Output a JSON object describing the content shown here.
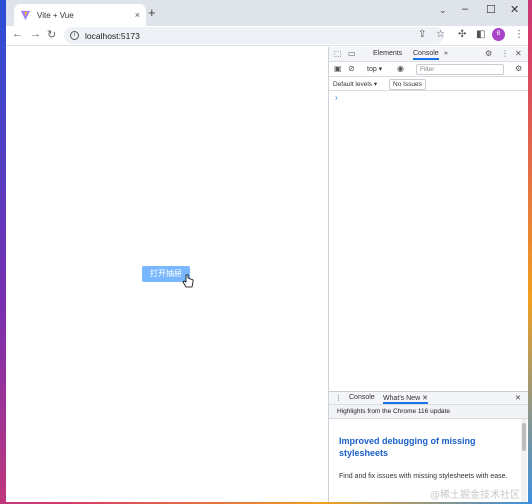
{
  "browser": {
    "tab_title": "Vite + Vue",
    "tab_close": "×",
    "new_tab": "+",
    "tab_list_chevron": "⌄",
    "window_controls": {
      "minimize": "–",
      "maximize": "☐",
      "close": "✕"
    },
    "url": "localhost:5173",
    "profile_initial": "B",
    "favicon": "vite-icon",
    "accent_color": "#1a73e8"
  },
  "page": {
    "button_label": "打开抽屉",
    "button_color": "#79b8ff"
  },
  "devtools": {
    "tabs": [
      "Elements",
      "Console"
    ],
    "more_tabs": "»",
    "context": "top",
    "filter_placeholder": "Filter",
    "levels": "Default levels ▾",
    "issues": "No Issues",
    "prompt": "›",
    "drawer_tabs": [
      "Console",
      "What's New"
    ],
    "highlights": "Highlights from the Chrome 116 update",
    "whats_new_heading": "Improved debugging of missing stylesheets",
    "whats_new_body": "Find and fix issues with missing stylesheets with ease."
  },
  "watermark": "@稀土掘金技术社区"
}
